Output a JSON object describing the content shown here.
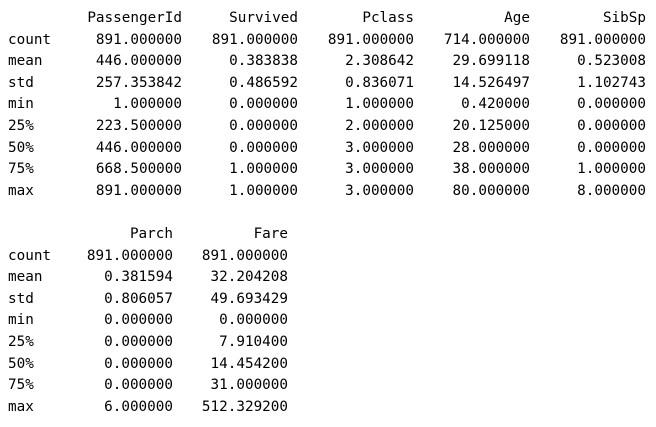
{
  "block1": {
    "columns": [
      "PassengerId",
      "Survived",
      "Pclass",
      "Age",
      "SibSp"
    ],
    "rows": [
      {
        "label": "count",
        "values": [
          "891.000000",
          "891.000000",
          "891.000000",
          "714.000000",
          "891.000000"
        ]
      },
      {
        "label": "mean",
        "values": [
          "446.000000",
          "0.383838",
          "2.308642",
          "29.699118",
          "0.523008"
        ]
      },
      {
        "label": "std",
        "values": [
          "257.353842",
          "0.486592",
          "0.836071",
          "14.526497",
          "1.102743"
        ]
      },
      {
        "label": "min",
        "values": [
          "1.000000",
          "0.000000",
          "1.000000",
          "0.420000",
          "0.000000"
        ]
      },
      {
        "label": "25%",
        "values": [
          "223.500000",
          "0.000000",
          "2.000000",
          "20.125000",
          "0.000000"
        ]
      },
      {
        "label": "50%",
        "values": [
          "446.000000",
          "0.000000",
          "3.000000",
          "28.000000",
          "0.000000"
        ]
      },
      {
        "label": "75%",
        "values": [
          "668.500000",
          "1.000000",
          "3.000000",
          "38.000000",
          "1.000000"
        ]
      },
      {
        "label": "max",
        "values": [
          "891.000000",
          "1.000000",
          "3.000000",
          "80.000000",
          "8.000000"
        ]
      }
    ]
  },
  "block2": {
    "columns": [
      "Parch",
      "Fare"
    ],
    "rows": [
      {
        "label": "count",
        "values": [
          "891.000000",
          "891.000000"
        ]
      },
      {
        "label": "mean",
        "values": [
          "0.381594",
          "32.204208"
        ]
      },
      {
        "label": "std",
        "values": [
          "0.806057",
          "49.693429"
        ]
      },
      {
        "label": "min",
        "values": [
          "0.000000",
          "0.000000"
        ]
      },
      {
        "label": "25%",
        "values": [
          "0.000000",
          "7.910400"
        ]
      },
      {
        "label": "50%",
        "values": [
          "0.000000",
          "14.454200"
        ]
      },
      {
        "label": "75%",
        "values": [
          "0.000000",
          "31.000000"
        ]
      },
      {
        "label": "max",
        "values": [
          "6.000000",
          "512.329200"
        ]
      }
    ]
  }
}
